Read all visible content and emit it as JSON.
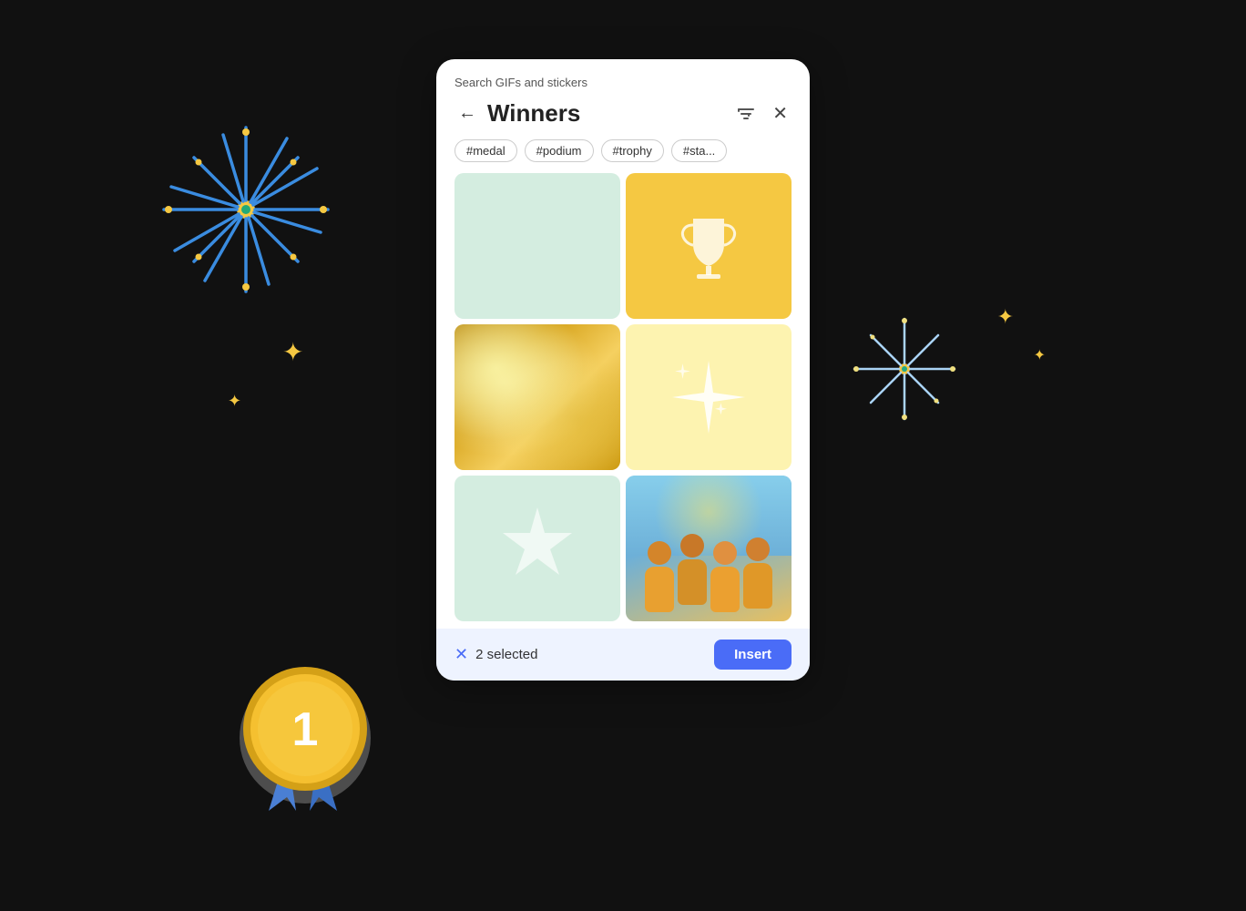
{
  "search_label": "Search GIFs and stickers",
  "nav": {
    "title": "Winners",
    "back_label": "←",
    "filter_label": "⊞",
    "close_label": "✕"
  },
  "tags": [
    {
      "label": "#medal"
    },
    {
      "label": "#podium"
    },
    {
      "label": "#trophy"
    },
    {
      "label": "#sta..."
    }
  ],
  "grid_cells": [
    {
      "type": "mint",
      "id": "cell-1"
    },
    {
      "type": "trophy",
      "id": "cell-2"
    },
    {
      "type": "glitter",
      "id": "cell-3"
    },
    {
      "type": "sparkle",
      "id": "cell-4"
    },
    {
      "type": "star",
      "id": "cell-5"
    },
    {
      "type": "photo",
      "id": "cell-6"
    }
  ],
  "bottom_bar": {
    "selected_count": "2 selected",
    "insert_label": "Insert"
  }
}
